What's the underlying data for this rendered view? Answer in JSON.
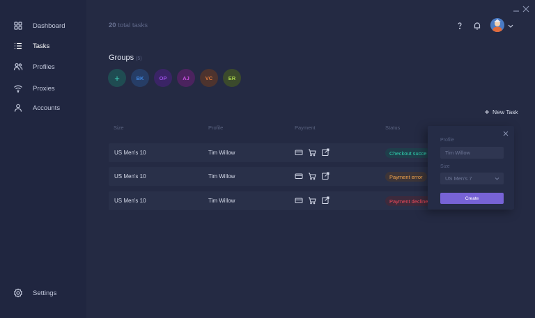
{
  "sidebar": {
    "items": [
      {
        "label": "Dashboard",
        "icon": "dashboard-icon",
        "active": false
      },
      {
        "label": "Tasks",
        "icon": "list-icon",
        "active": true
      },
      {
        "label": "Profiles",
        "icon": "users-icon",
        "active": false
      },
      {
        "label": "Proxies",
        "icon": "wifi-icon",
        "active": false
      },
      {
        "label": "Accounts",
        "icon": "user-icon",
        "active": false
      }
    ],
    "settings_label": "Settings"
  },
  "header": {
    "total_count": "20",
    "total_label": "total tasks"
  },
  "groups": {
    "title": "Groups",
    "count": "(5)",
    "add_glyph": "+",
    "items": [
      {
        "initials": "BK",
        "bg": "#263d66",
        "fg": "#3f86e0"
      },
      {
        "initials": "OP",
        "bg": "#3a2466",
        "fg": "#9b4fe6"
      },
      {
        "initials": "AJ",
        "bg": "#4b235e",
        "fg": "#c84fe0"
      },
      {
        "initials": "VC",
        "bg": "#4d332e",
        "fg": "#e07a3a"
      },
      {
        "initials": "ER",
        "bg": "#3b4a2c",
        "fg": "#a8d24a"
      }
    ],
    "add_bg": "#1f4c52",
    "add_fg": "#3ed0b8"
  },
  "toolbar": {
    "new_task_label": "New Task"
  },
  "table": {
    "headers": {
      "size": "Size",
      "profile": "Profile",
      "payment": "Payment",
      "status": "Status"
    },
    "rows": [
      {
        "size": "US Men's 10",
        "profile": "Tim Willow",
        "status": "Checkout succe",
        "status_color": "#2fd0ae",
        "status_bg": "#1f3e4b"
      },
      {
        "size": "US Men's 10",
        "profile": "Tim Willow",
        "status": "Payment error",
        "status_color": "#f0a24a",
        "status_bg": "#3d3538"
      },
      {
        "size": "US Men's 10",
        "profile": "Tim Willow",
        "status": "Payment decline",
        "status_color": "#ef4a5a",
        "status_bg": "#3d2a3c"
      }
    ]
  },
  "popup": {
    "profile_label": "Profile",
    "profile_value": "Tim Willow",
    "size_label": "Size",
    "size_value": "US Men's 7",
    "create_label": "Create"
  },
  "colors": {
    "accent": "#7763d6",
    "background": "#242a43",
    "sidebar": "#202640"
  }
}
